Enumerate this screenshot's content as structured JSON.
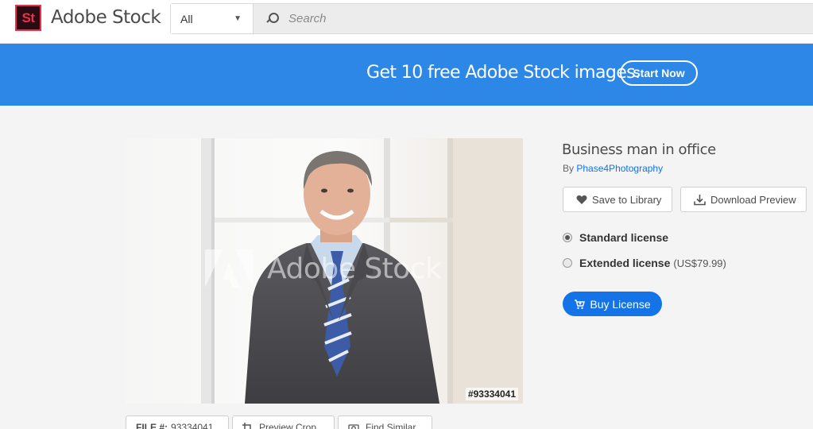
{
  "header": {
    "logo_mark": "St",
    "logo_text": "Adobe Stock",
    "search_scope": "All",
    "search_placeholder": "Search"
  },
  "banner": {
    "text": "Get 10 free Adobe Stock images.",
    "cta": "Start Now"
  },
  "photo": {
    "watermark": "Adobe Stock",
    "file_overlay": "#93334041"
  },
  "details": {
    "title": "Business man in office",
    "by_label": "By",
    "author": "Phase4Photography",
    "save_label": "Save to Library",
    "download_label": "Download Preview",
    "licenses": [
      {
        "label": "Standard license",
        "price": "",
        "selected": true
      },
      {
        "label": "Extended license",
        "price": "(US$79.99)",
        "selected": false
      }
    ],
    "buy_label": "Buy License"
  },
  "toolbar": {
    "file_label": "FILE #:",
    "file_number": "93334041",
    "crop_label": "Preview Crop",
    "similar_label": "Find Similar"
  },
  "colors": {
    "brand_blue": "#2d87e6",
    "primary_button": "#1473e6",
    "logo_red": "#e8324b"
  }
}
